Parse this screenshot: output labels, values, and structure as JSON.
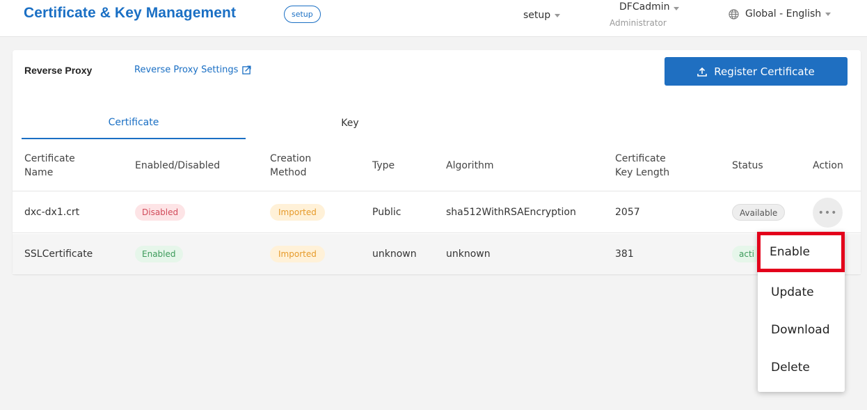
{
  "header": {
    "title": "Certificate & Key Management",
    "badge": "setup",
    "project_select": "setup",
    "user_name": "DFCadmin",
    "user_role": "Administrator",
    "language": "Global - English"
  },
  "card": {
    "section_label": "Reverse Proxy",
    "settings_link": "Reverse Proxy Settings",
    "register_button": "Register Certificate",
    "tabs": [
      {
        "label": "Certificate"
      },
      {
        "label": "Key"
      }
    ]
  },
  "table": {
    "headers": {
      "name": "Certificate Name",
      "enabled": "Enabled/Disabled",
      "method": "Creation Method",
      "type": "Type",
      "algorithm": "Algorithm",
      "key_length": "Certificate Key Length",
      "status": "Status",
      "action": "Action"
    },
    "header_lines": {
      "name": [
        "Certificate",
        "Name"
      ],
      "method": [
        "Creation",
        "Method"
      ],
      "key_length": [
        "Certificate",
        "Key Length"
      ]
    },
    "rows": [
      {
        "name": "dxc-dx1.crt",
        "enabled": "Disabled",
        "method": "Imported",
        "type": "Public",
        "algorithm": "sha512WithRSAEncryption",
        "key_length": "2057",
        "status": "Available",
        "action": "•••"
      },
      {
        "name": "SSLCertificate",
        "enabled": "Enabled",
        "method": "Imported",
        "type": "unknown",
        "algorithm": "unknown",
        "key_length": "381",
        "status": "acti"
      }
    ]
  },
  "menu": {
    "items": [
      {
        "label": "Enable"
      },
      {
        "label": "Update"
      },
      {
        "label": "Download"
      },
      {
        "label": "Delete"
      }
    ]
  },
  "colors": {
    "accent": "#1a6fc4",
    "highlight": "#e3001b",
    "disabled": "#d14a5a",
    "enabled": "#3c9a5a",
    "imported": "#e69a2a"
  }
}
